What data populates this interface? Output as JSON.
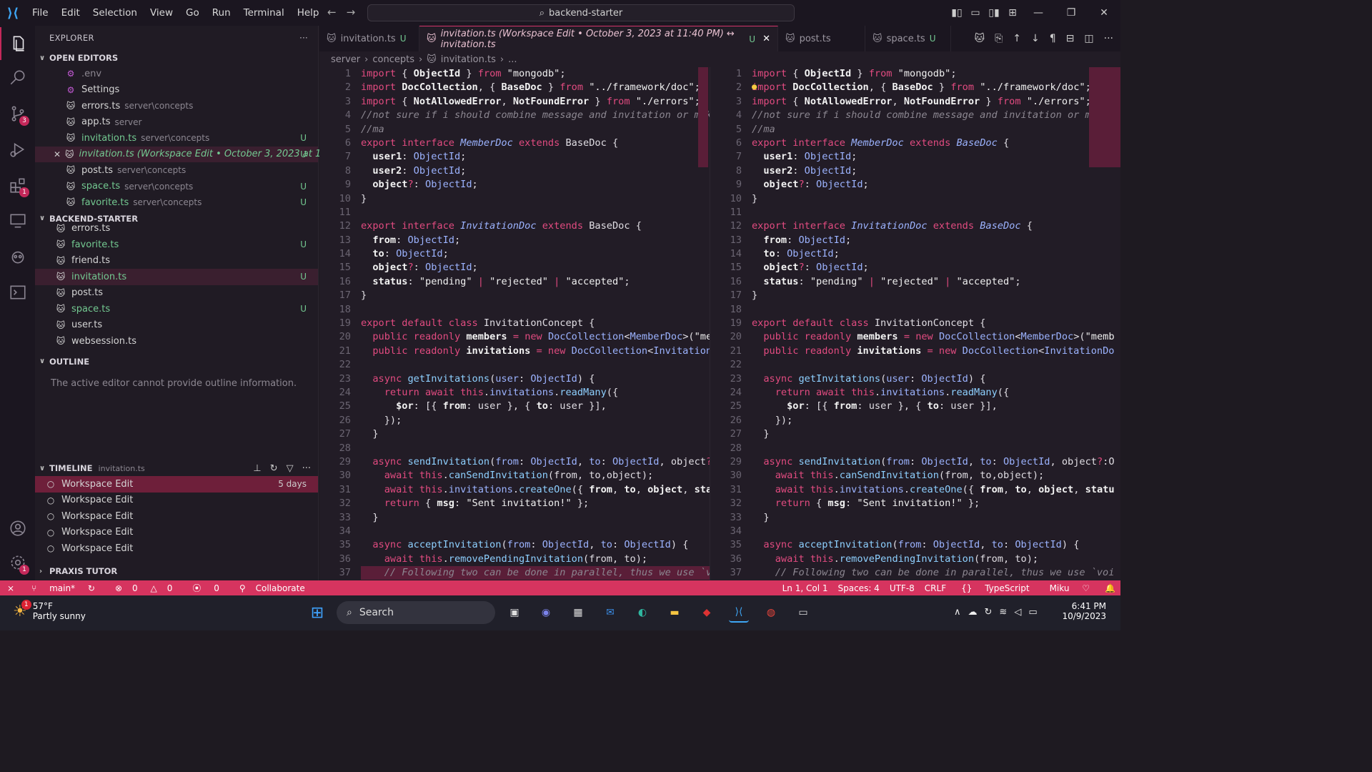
{
  "title_bar": {
    "menu": [
      "File",
      "Edit",
      "Selection",
      "View",
      "Go",
      "Run",
      "Terminal",
      "Help"
    ],
    "command_center": "backend-starter"
  },
  "sidebar": {
    "title": "EXPLORER",
    "open_editors_label": "OPEN EDITORS",
    "open_editors": [
      {
        "name": ".env",
        "desc": ""
      },
      {
        "name": "Settings",
        "desc": ""
      },
      {
        "name": "errors.ts",
        "desc": "server\\concepts"
      },
      {
        "name": "app.ts",
        "desc": "server"
      },
      {
        "name": "invitation.ts",
        "desc": "server\\concepts",
        "status": "U"
      },
      {
        "name": "invitation.ts (Workspace Edit • October 3, 2023 at 1...",
        "desc": "",
        "status": "U"
      },
      {
        "name": "post.ts",
        "desc": "server\\concepts"
      },
      {
        "name": "space.ts",
        "desc": "server\\concepts",
        "status": "U"
      },
      {
        "name": "favorite.ts",
        "desc": "server\\concepts",
        "status": "U"
      }
    ],
    "project_label": "BACKEND-STARTER",
    "project_files": [
      {
        "name": "errors.ts"
      },
      {
        "name": "favorite.ts",
        "status": "U"
      },
      {
        "name": "friend.ts"
      },
      {
        "name": "invitation.ts",
        "status": "U"
      },
      {
        "name": "post.ts"
      },
      {
        "name": "space.ts",
        "status": "U"
      },
      {
        "name": "user.ts"
      },
      {
        "name": "websession.ts"
      }
    ],
    "outline_label": "OUTLINE",
    "outline_msg": "The active editor cannot provide outline information.",
    "timeline_label": "TIMELINE",
    "timeline_file": "invitation.ts",
    "timeline_items": [
      {
        "label": "Workspace Edit",
        "time": "5 days"
      },
      {
        "label": "Workspace Edit",
        "time": ""
      },
      {
        "label": "Workspace Edit",
        "time": ""
      },
      {
        "label": "Workspace Edit",
        "time": ""
      },
      {
        "label": "Workspace Edit",
        "time": ""
      }
    ],
    "praxis_label": "PRAXIS TUTOR"
  },
  "tabs": [
    {
      "label": "invitation.ts",
      "status": "U"
    },
    {
      "label": "invitation.ts (Workspace Edit • October 3, 2023 at 11:40 PM) ↔ invitation.ts",
      "status": "U"
    },
    {
      "label": "post.ts",
      "status": ""
    },
    {
      "label": "space.ts",
      "status": "U"
    }
  ],
  "breadcrumb": [
    "server",
    "concepts",
    "invitation.ts",
    "..."
  ],
  "code_lines": [
    "1",
    "2",
    "3",
    "4",
    "5",
    "6",
    "7",
    "8",
    "9",
    "10",
    "11",
    "12",
    "13",
    "14",
    "15",
    "16",
    "17",
    "18",
    "19",
    "20",
    "21",
    "22",
    "23",
    "24",
    "25",
    "26",
    "27",
    "28",
    "29",
    "30",
    "31",
    "32",
    "33",
    "34",
    "35",
    "36",
    "37"
  ],
  "status": {
    "branch": "main*",
    "errors": "0",
    "warnings": "0",
    "ports": "0",
    "collab": "Collaborate",
    "position": "Ln 1, Col 1",
    "spaces": "Spaces: 4",
    "encoding": "UTF-8",
    "eol": "CRLF",
    "language": "TypeScript",
    "theme": "Miku"
  },
  "taskbar": {
    "temp": "57°F",
    "weather": "Partly sunny",
    "weather_badge": "1",
    "search": "Search",
    "time": "6:41 PM",
    "date": "10/9/2023"
  },
  "colors": {
    "accent": "#d6345f",
    "bg": "#221c26"
  }
}
